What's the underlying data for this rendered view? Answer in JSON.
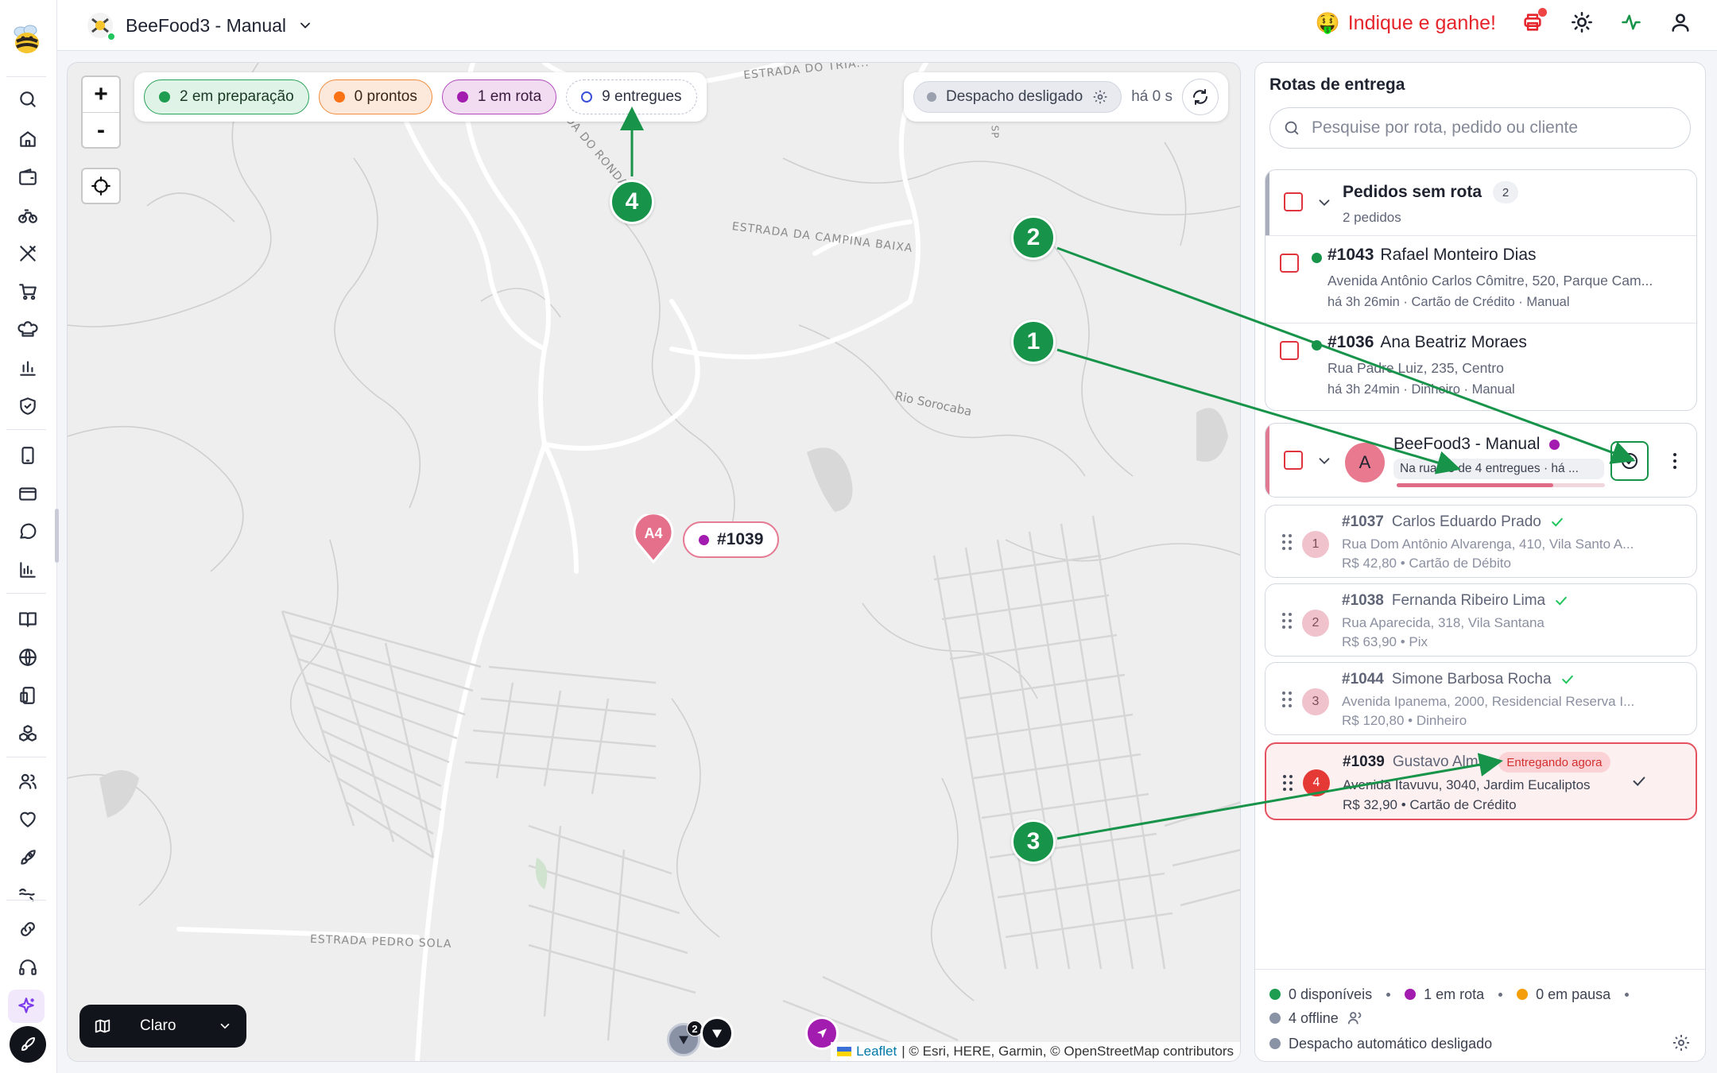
{
  "header": {
    "store_name": "BeeFood3 - Manual",
    "refer_label": "Indique e ganhe!",
    "refer_emoji": "🤑"
  },
  "sidebar": {
    "icons": [
      "search-icon",
      "home-icon",
      "wallet-icon",
      "bike-icon",
      "utensils-icon",
      "cart-icon",
      "chef-hat-icon",
      "bar-chart-icon",
      "shield-check-icon",
      "tablet-icon",
      "credit-card-icon",
      "chat-icon",
      "analytics-icon",
      "book-icon",
      "globe-icon",
      "devices-icon",
      "boxes-icon",
      "users-icon",
      "heart-icon",
      "rocket-icon",
      "delivery-icon",
      "link-icon",
      "headset-icon",
      "sparkles-icon",
      "rocket-launch-icon"
    ]
  },
  "map": {
    "zoom_in": "+",
    "zoom_out": "-",
    "filters": {
      "prep": "2 em preparação",
      "ready": "0 prontos",
      "route": "1 em rota",
      "delivered": "9 entregues"
    },
    "dispatch": {
      "label": "Despacho desligado",
      "time": "há 0 s"
    },
    "roads": [
      "ESTRADA DO TRIÂ...",
      "ADA DO RONDA",
      "ESTRADA DA CAMPINA BAIXA",
      "Rio Sorocaba",
      "ESTRADA PEDRO SOLA",
      "SP"
    ],
    "pin_label": "A4",
    "order_tag": "#1039",
    "cluster_count": "2",
    "theme": "Claro",
    "attribution_leaflet": "Leaflet",
    "attribution_rest": "| © Esri, HERE, Garmin, © OpenStreetMap contributors"
  },
  "annotations": [
    "1",
    "2",
    "3",
    "4"
  ],
  "panel": {
    "title": "Rotas de entrega",
    "search_placeholder": "Pesquise por rota, pedido ou cliente",
    "unrouted": {
      "title": "Pedidos sem rota",
      "count": "2",
      "subtitle": "2 pedidos",
      "orders": [
        {
          "id": "#1043",
          "name": "Rafael Monteiro Dias",
          "address": "Avenida Antônio Carlos Cômitre, 520, Parque Cam...",
          "meta": "há 3h 26min · Cartão de Crédito · Manual"
        },
        {
          "id": "#1036",
          "name": "Ana Beatriz Moraes",
          "address": "Rua Padre Luiz, 235, Centro",
          "meta": "há 3h 24min · Dinheiro · Manual"
        }
      ]
    },
    "route": {
      "avatar": "A",
      "name": "BeeFood3 - Manual",
      "status": "Na rua · 3 de 4 entregues · há ...",
      "progress": 0.75,
      "stops": [
        {
          "num": "1",
          "id": "#1037",
          "name": "Carlos Eduardo Prado",
          "address": "Rua Dom Antônio Alvarenga, 410, Vila Santo A...",
          "meta": "R$ 42,80 • Cartão de Débito"
        },
        {
          "num": "2",
          "id": "#1038",
          "name": "Fernanda Ribeiro Lima",
          "address": "Rua Aparecida, 318, Vila Santana",
          "meta": "R$ 63,90 • Pix"
        },
        {
          "num": "3",
          "id": "#1044",
          "name": "Simone Barbosa Rocha",
          "address": "Avenida Ipanema, 2000, Residencial Reserva I...",
          "meta": "R$ 120,80 • Dinheiro"
        },
        {
          "num": "4",
          "id": "#1039",
          "name": "Gustavo Alm...",
          "badge": "Entregando agora",
          "address": "Avenida Itavuvu, 3040, Jardim Eucaliptos",
          "meta": "R$ 32,90 • Cartão de Crédito"
        }
      ]
    },
    "footer": {
      "available": "0 disponíveis",
      "in_route": "1 em rota",
      "paused": "0 em pausa",
      "offline": "4 offline",
      "auto_dispatch": "Despacho automático desligado"
    }
  },
  "colors": {
    "prep": "#1e9c4f",
    "ready": "#f97316",
    "route": "#a21caf",
    "danger": "#e53935",
    "route_accent": "#e07a92",
    "annotation": "#17934a"
  }
}
